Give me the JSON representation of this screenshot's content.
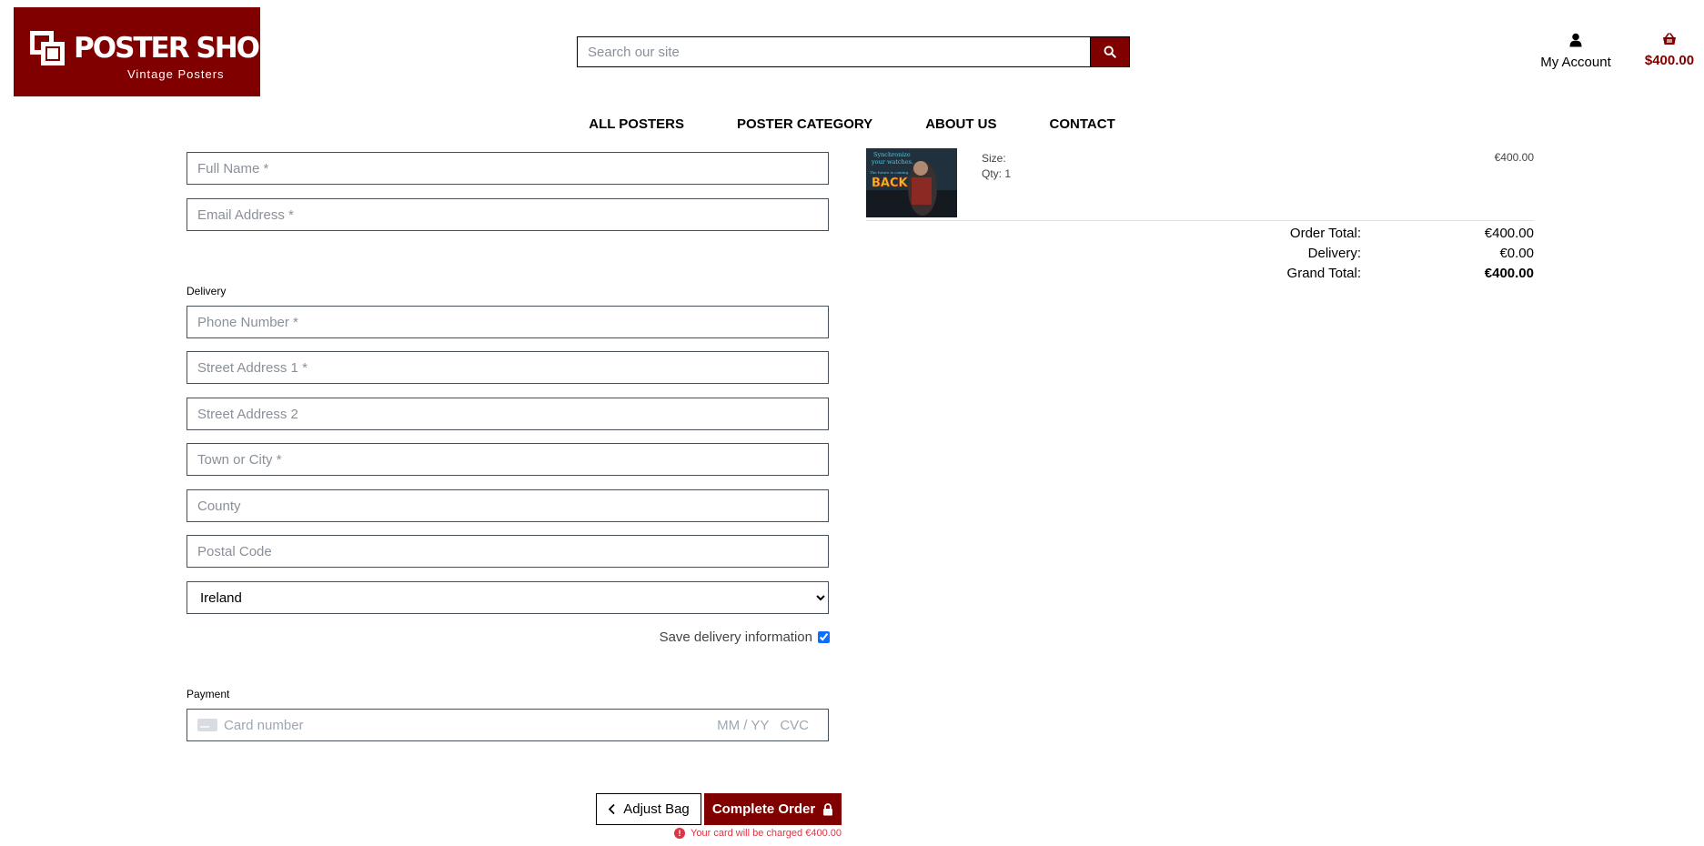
{
  "brand": {
    "title": "POSTER SHOP",
    "subtitle": "Vintage Posters",
    "color": "#800000"
  },
  "header": {
    "search_placeholder": "Search our site",
    "account_label": "My Account",
    "bag_total": "$400.00"
  },
  "nav": {
    "items": [
      {
        "label": "ALL POSTERS"
      },
      {
        "label": "POSTER CATEGORY"
      },
      {
        "label": "ABOUT US"
      },
      {
        "label": "CONTACT"
      }
    ]
  },
  "form": {
    "full_name_placeholder": "Full Name *",
    "email_placeholder": "Email Address *",
    "delivery_label": "Delivery",
    "phone_placeholder": "Phone Number *",
    "street1_placeholder": "Street Address 1 *",
    "street2_placeholder": "Street Address 2",
    "town_placeholder": "Town or City *",
    "county_placeholder": "County",
    "postcode_placeholder": "Postal Code",
    "country_selected": "Ireland",
    "save_label": "Save delivery information",
    "save_checked": true,
    "payment_label": "Payment",
    "card_placeholder": "Card number",
    "expiry_placeholder": "MM / YY",
    "cvc_placeholder": "CVC"
  },
  "actions": {
    "adjust_label": "Adjust Bag",
    "complete_label": "Complete Order",
    "charge_note_prefix": "Your card will be charged",
    "charge_amount": "€400.00"
  },
  "summary": {
    "product": {
      "image_text_line1": "Synchronize",
      "image_text_line2": "your watches.",
      "image_text_line3": "The future is coming.",
      "image_text_line4": "BACK",
      "size_label": "Size:",
      "qty_label": "Qty: 1",
      "price": "€400.00"
    },
    "order_total_label": "Order Total:",
    "order_total_value": "€400.00",
    "delivery_label": "Delivery:",
    "delivery_value": "€0.00",
    "grand_total_label": "Grand Total:",
    "grand_total_value": "€400.00"
  }
}
